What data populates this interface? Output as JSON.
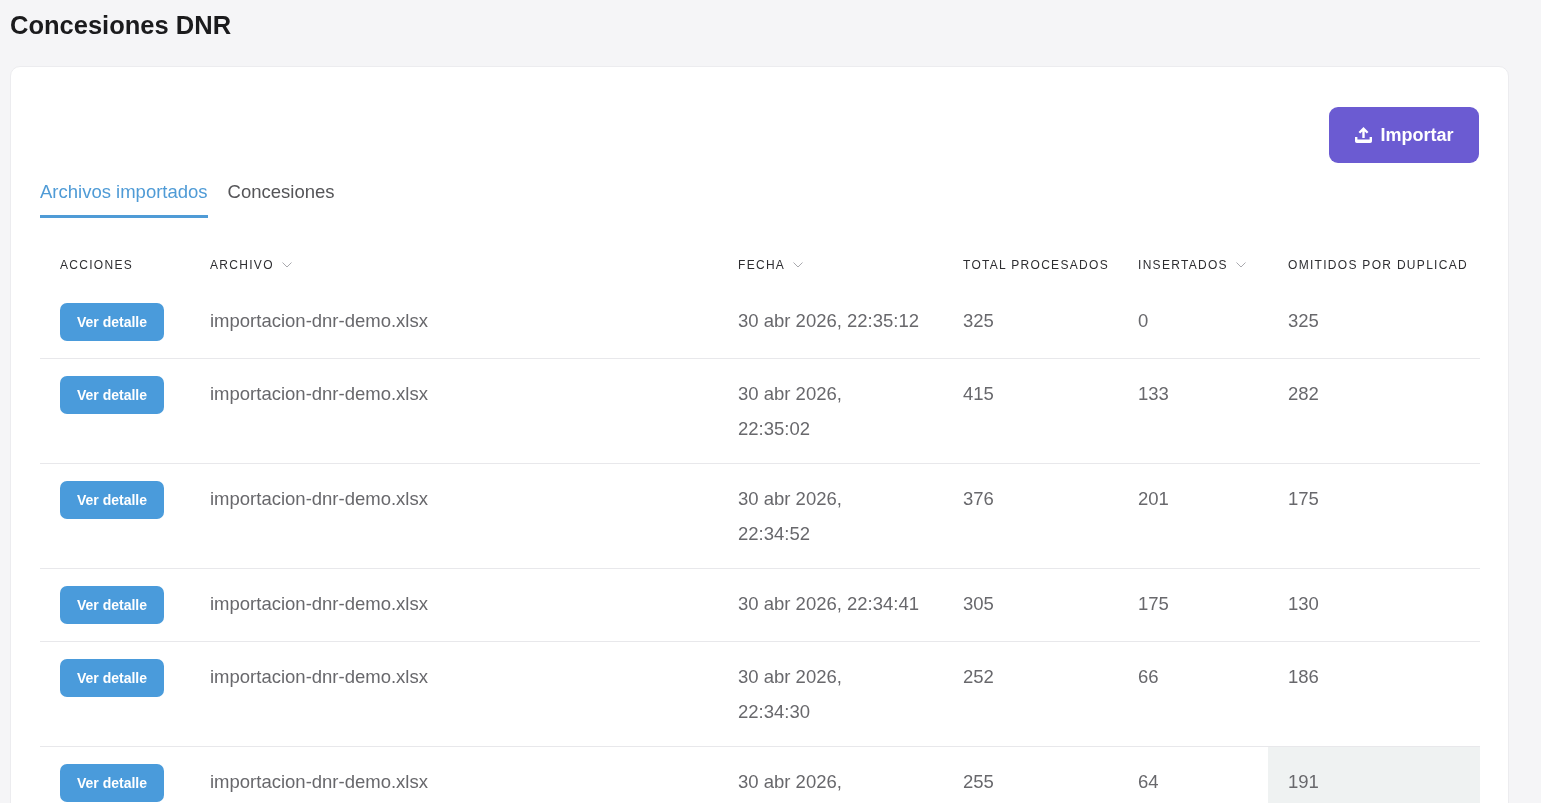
{
  "page": {
    "title": "Concesiones DNR"
  },
  "toolbar": {
    "import_button": "Importar"
  },
  "tabs": [
    {
      "label": "Archivos importados",
      "selected": true
    },
    {
      "label": "Concesiones",
      "selected": false
    }
  ],
  "table": {
    "columns": [
      {
        "label": "ACCIONES",
        "sortable": false
      },
      {
        "label": "ARCHIVO",
        "sortable": true
      },
      {
        "label": "FECHA",
        "sortable": true
      },
      {
        "label": "TOTAL PROCESADOS",
        "sortable": false
      },
      {
        "label": "INSERTADOS",
        "sortable": true
      },
      {
        "label": "OMITIDOS POR DUPLICAD",
        "sortable": false
      }
    ],
    "rows": [
      {
        "action": "Ver detalle",
        "archivo": "importacion-dnr-demo.xlsx",
        "fecha": [
          "30 abr 2026, 22:35:12"
        ],
        "total": "325",
        "insertados": "0",
        "omitidos": "325",
        "omitidos_hovered": false
      },
      {
        "action": "Ver detalle",
        "archivo": "importacion-dnr-demo.xlsx",
        "fecha": [
          "30 abr 2026,",
          "22:35:02"
        ],
        "total": "415",
        "insertados": "133",
        "omitidos": "282",
        "omitidos_hovered": false
      },
      {
        "action": "Ver detalle",
        "archivo": "importacion-dnr-demo.xlsx",
        "fecha": [
          "30 abr 2026,",
          "22:34:52"
        ],
        "total": "376",
        "insertados": "201",
        "omitidos": "175",
        "omitidos_hovered": false
      },
      {
        "action": "Ver detalle",
        "archivo": "importacion-dnr-demo.xlsx",
        "fecha": [
          "30 abr 2026, 22:34:41"
        ],
        "total": "305",
        "insertados": "175",
        "omitidos": "130",
        "omitidos_hovered": false
      },
      {
        "action": "Ver detalle",
        "archivo": "importacion-dnr-demo.xlsx",
        "fecha": [
          "30 abr 2026,",
          "22:34:30"
        ],
        "total": "252",
        "insertados": "66",
        "omitidos": "186",
        "omitidos_hovered": false
      },
      {
        "action": "Ver detalle",
        "archivo": "importacion-dnr-demo.xlsx",
        "fecha": [
          "30 abr 2026,"
        ],
        "total": "255",
        "insertados": "64",
        "omitidos": "191",
        "omitidos_hovered": true
      }
    ]
  }
}
